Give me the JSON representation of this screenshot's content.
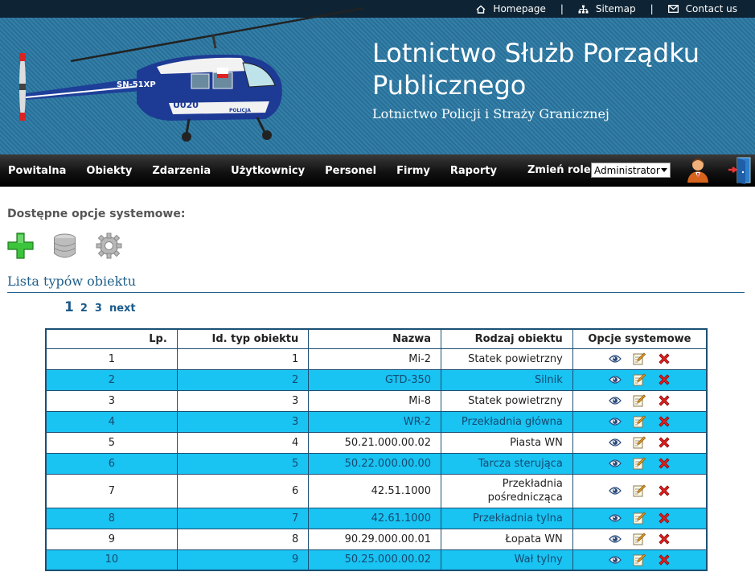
{
  "topbar": {
    "homepage": "Homepage",
    "sitemap": "Sitemap",
    "contact": "Contact us",
    "separator": "|"
  },
  "header": {
    "title": "Lotnictwo Służb Porządku Publicznego",
    "subtitle": "Lotnictwo Policji i Straży Granicznej",
    "heli_registration": "SN-51XP",
    "heli_number": "U020",
    "heli_label": "POLICJA"
  },
  "nav": {
    "items": [
      "Powitalna",
      "Obiekty",
      "Zdarzenia",
      "Użytkownicy",
      "Personel",
      "Firmy",
      "Raporty"
    ],
    "role_label": "Zmień role:",
    "role_value": "Administrator"
  },
  "options": {
    "heading": "Dostępne opcje systemowe:",
    "icons": [
      "add-icon",
      "database-icon",
      "settings-gear-icon"
    ]
  },
  "list": {
    "title": "Lista typów obiektu",
    "pager": {
      "current": "1",
      "pages": [
        "2",
        "3"
      ],
      "next": "next"
    }
  },
  "table": {
    "headers": {
      "lp": "Lp.",
      "id": "Id. typ obiektu",
      "name": "Nazwa",
      "kind": "Rodzaj obiektu",
      "options": "Opcje systemowe"
    },
    "rows": [
      {
        "lp": "1",
        "id": "1",
        "name": "Mi-2",
        "kind": "Statek powietrzny"
      },
      {
        "lp": "2",
        "id": "2",
        "name": "GTD-350",
        "kind": "Silnik"
      },
      {
        "lp": "3",
        "id": "3",
        "name": "Mi-8",
        "kind": "Statek powietrzny"
      },
      {
        "lp": "4",
        "id": "3",
        "name": "WR-2",
        "kind": "Przekładnia główna"
      },
      {
        "lp": "5",
        "id": "4",
        "name": "50.21.000.00.02",
        "kind": "Piasta WN"
      },
      {
        "lp": "6",
        "id": "5",
        "name": "50.22.000.00.00",
        "kind": "Tarcza sterująca"
      },
      {
        "lp": "7",
        "id": "6",
        "name": "42.51.1000",
        "kind_line1": "Przekładnia",
        "kind_line2": "pośrednicząca"
      },
      {
        "lp": "8",
        "id": "7",
        "name": "42.61.1000",
        "kind": "Przekładnia tylna"
      },
      {
        "lp": "9",
        "id": "8",
        "name": "90.29.000.00.01",
        "kind": "Łopata WN"
      },
      {
        "lp": "10",
        "id": "9",
        "name": "50.25.000.00.02",
        "kind": "Wał tylny"
      }
    ],
    "row_actions": [
      "view-eye-icon",
      "edit-icon",
      "delete-x-icon"
    ]
  },
  "colors": {
    "topbar_bg": "#0e2434",
    "header_bg": "#2a6f96",
    "nav_bg": "#111111",
    "row_alt_bg": "#19c3f2",
    "row_alt_text": "#154a70",
    "table_border": "#1c4f73",
    "link_blue": "#1a5a8a"
  }
}
